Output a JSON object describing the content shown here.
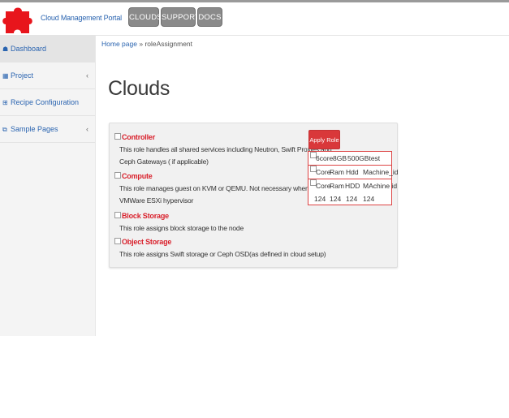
{
  "header": {
    "brand": "Cloud Management Portal",
    "nav": [
      {
        "label": "CLOUDS"
      },
      {
        "label": "SUPPORT"
      },
      {
        "label": "DOCS"
      }
    ]
  },
  "sidebar": {
    "items": [
      {
        "label": "Dashboard",
        "icon": "home-icon"
      },
      {
        "label": "Project",
        "icon": "bar-chart-icon"
      },
      {
        "label": "Recipe Configuration",
        "icon": "grid-icon"
      },
      {
        "label": "Sample Pages",
        "icon": "copy-icon"
      }
    ]
  },
  "breadcrumb": {
    "home": "Home page",
    "separator": "»",
    "current": "roleAssignment"
  },
  "page_title": "Clouds",
  "roles": [
    {
      "name": "Controller",
      "desc_lines": [
        "This role handles all shared services including Neutron, Swift Proxies and",
        "Ceph Gateways ( if applicable)"
      ]
    },
    {
      "name": "Compute",
      "desc_lines": [
        "This role manages guest on KVM or QEMU. Not necessary when using",
        "VMWare ESXi hypervisor"
      ]
    },
    {
      "name": "Block Storage",
      "desc_lines": [
        "This role assigns block storage to the node"
      ]
    },
    {
      "name": "Object Storage",
      "desc_lines": [
        "This role assigns Swift storage or Ceph OSD(as defined in cloud setup)"
      ]
    }
  ],
  "apply_button": "Apply Role",
  "hardware": {
    "box1": {
      "row1": [
        "6core",
        "8GB",
        "500GBtest"
      ]
    },
    "box2": {
      "header": [
        "Core",
        "Ram",
        "Hdd",
        "Machine_id"
      ]
    },
    "box3": {
      "header": [
        "Core",
        "Ram",
        "HDD",
        "MAchine id"
      ],
      "values": [
        "124",
        "124",
        "124",
        "124"
      ]
    }
  },
  "colors": {
    "accent_red": "#d9202b",
    "link_blue": "#2a64b0",
    "nav_button": "#8a8a8a"
  }
}
